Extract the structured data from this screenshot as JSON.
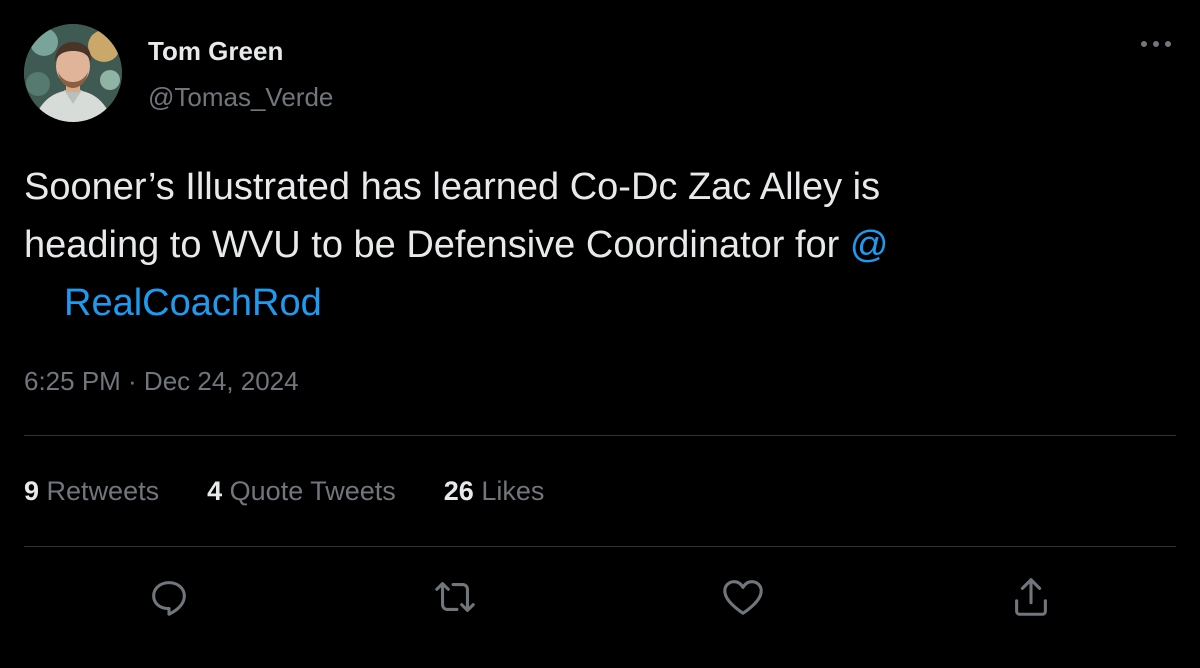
{
  "author": {
    "display_name": "Tom Green",
    "handle": "@Tomas_Verde"
  },
  "tweet": {
    "line1": "Sooner’s Illustrated has learned Co-Dc Zac Alley is",
    "line2": "heading to WVU to be Defensive Coordinator for",
    "mention_at": "@",
    "mention_name": "RealCoachRod",
    "timestamp": "6:25 PM · Dec 24, 2024"
  },
  "stats": {
    "retweets_count": "9",
    "retweets_label": "Retweets",
    "quotes_count": "4",
    "quotes_label": "Quote Tweets",
    "likes_count": "26",
    "likes_label": "Likes"
  },
  "colors": {
    "background": "#000000",
    "text_primary": "#e7e9ea",
    "text_secondary": "#71767b",
    "link": "#1d9bf0",
    "divider": "#2f3336"
  },
  "icons": {
    "more": "more-dots-icon",
    "reply": "reply-icon",
    "retweet": "retweet-icon",
    "like": "like-icon",
    "share": "share-icon"
  }
}
